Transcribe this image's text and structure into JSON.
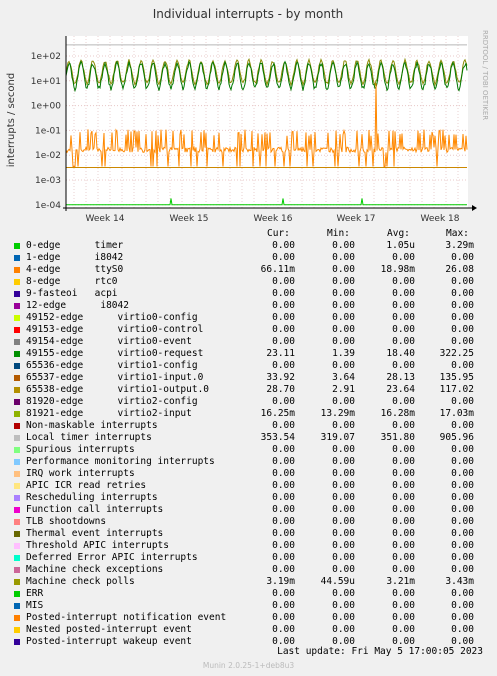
{
  "chart_data": {
    "type": "line",
    "title": "Individual interrupts - by month",
    "ylabel": "interrupts / second",
    "side_label": "RRDTOOL / TOBI OETIKER",
    "yscale": "log",
    "ylim": [
      0.0001,
      300
    ],
    "yticks": [
      "1e+02",
      "1e+01",
      "1e+00",
      "1e-01",
      "1e-02",
      "1e-03",
      "1e-04"
    ],
    "xticks": [
      "Week 14",
      "Week 15",
      "Week 16",
      "Week 17",
      "Week 18"
    ],
    "series_colors": {
      "timer": "#00cc00",
      "local_timer": "#b8b8b8",
      "virtio1_input": "#888800",
      "virtio0_request": "#007700",
      "ttyS0": "#ff8800",
      "mce_polls": "#cc8800",
      "nmi": "#880000"
    },
    "series": [
      {
        "name": "Local timer interrupts",
        "typical": 352,
        "min": 319,
        "max": 906
      },
      {
        "name": "65537-edge virtio1-input.0",
        "typical": 28,
        "min": 3.6,
        "max": 136
      },
      {
        "name": "49155-edge virtio0-request",
        "typical": 18,
        "min": 1.4,
        "max": 322
      },
      {
        "name": "4-edge ttyS0",
        "typical": 0.019,
        "min": 0,
        "max": 26
      },
      {
        "name": "Machine check polls",
        "typical": 0.0032,
        "min": 0.0032,
        "max": 0.0034
      },
      {
        "name": "0-edge timer",
        "typical": 1e-06,
        "min": 0,
        "max": 0.0033
      }
    ]
  },
  "legend": {
    "headers": {
      "cur": "Cur:",
      "min": "Min:",
      "avg": "Avg:",
      "max": "Max:"
    },
    "rows": [
      {
        "color": "#00cc00",
        "name": "0-edge      timer",
        "cur": "0.00",
        "min": "0.00",
        "avg": "1.05u",
        "max": "3.29m"
      },
      {
        "color": "#0066b3",
        "name": "1-edge      i8042",
        "cur": "0.00",
        "min": "0.00",
        "avg": "0.00",
        "max": "0.00"
      },
      {
        "color": "#ff8000",
        "name": "4-edge      ttyS0",
        "cur": "66.11m",
        "min": "0.00",
        "avg": "18.98m",
        "max": "26.08"
      },
      {
        "color": "#ffcc00",
        "name": "8-edge      rtc0",
        "cur": "0.00",
        "min": "0.00",
        "avg": "0.00",
        "max": "0.00"
      },
      {
        "color": "#330099",
        "name": "9-fasteoi   acpi",
        "cur": "0.00",
        "min": "0.00",
        "avg": "0.00",
        "max": "0.00"
      },
      {
        "color": "#990099",
        "name": "12-edge      i8042",
        "cur": "0.00",
        "min": "0.00",
        "avg": "0.00",
        "max": "0.00"
      },
      {
        "color": "#ccff00",
        "name": "49152-edge      virtio0-config",
        "cur": "0.00",
        "min": "0.00",
        "avg": "0.00",
        "max": "0.00"
      },
      {
        "color": "#ff0000",
        "name": "49153-edge      virtio0-control",
        "cur": "0.00",
        "min": "0.00",
        "avg": "0.00",
        "max": "0.00"
      },
      {
        "color": "#808080",
        "name": "49154-edge      virtio0-event",
        "cur": "0.00",
        "min": "0.00",
        "avg": "0.00",
        "max": "0.00"
      },
      {
        "color": "#008f00",
        "name": "49155-edge      virtio0-request",
        "cur": "23.11",
        "min": "1.39",
        "avg": "18.40",
        "max": "322.25"
      },
      {
        "color": "#00487d",
        "name": "65536-edge      virtio1-config",
        "cur": "0.00",
        "min": "0.00",
        "avg": "0.00",
        "max": "0.00"
      },
      {
        "color": "#b35a00",
        "name": "65537-edge      virtio1-input.0",
        "cur": "33.92",
        "min": "3.64",
        "avg": "28.13",
        "max": "135.95"
      },
      {
        "color": "#b38f00",
        "name": "65538-edge      virtio1-output.0",
        "cur": "28.70",
        "min": "2.91",
        "avg": "23.64",
        "max": "117.02"
      },
      {
        "color": "#6b006b",
        "name": "81920-edge      virtio2-config",
        "cur": "0.00",
        "min": "0.00",
        "avg": "0.00",
        "max": "0.00"
      },
      {
        "color": "#8fb300",
        "name": "81921-edge      virtio2-input",
        "cur": "16.25m",
        "min": "13.29m",
        "avg": "16.28m",
        "max": "17.03m"
      },
      {
        "color": "#b30000",
        "name": "Non-maskable interrupts",
        "cur": "0.00",
        "min": "0.00",
        "avg": "0.00",
        "max": "0.00"
      },
      {
        "color": "#bebebe",
        "name": "Local timer interrupts",
        "cur": "353.54",
        "min": "319.07",
        "avg": "351.80",
        "max": "905.96"
      },
      {
        "color": "#80ff80",
        "name": "Spurious interrupts",
        "cur": "0.00",
        "min": "0.00",
        "avg": "0.00",
        "max": "0.00"
      },
      {
        "color": "#80c9ff",
        "name": "Performance monitoring interrupts",
        "cur": "0.00",
        "min": "0.00",
        "avg": "0.00",
        "max": "0.00"
      },
      {
        "color": "#ffc080",
        "name": "IRQ work interrupts",
        "cur": "0.00",
        "min": "0.00",
        "avg": "0.00",
        "max": "0.00"
      },
      {
        "color": "#ffe680",
        "name": "APIC ICR read retries",
        "cur": "0.00",
        "min": "0.00",
        "avg": "0.00",
        "max": "0.00"
      },
      {
        "color": "#aa80ff",
        "name": "Rescheduling interrupts",
        "cur": "0.00",
        "min": "0.00",
        "avg": "0.00",
        "max": "0.00"
      },
      {
        "color": "#ee00cc",
        "name": "Function call interrupts",
        "cur": "0.00",
        "min": "0.00",
        "avg": "0.00",
        "max": "0.00"
      },
      {
        "color": "#ff8080",
        "name": "TLB shootdowns",
        "cur": "0.00",
        "min": "0.00",
        "avg": "0.00",
        "max": "0.00"
      },
      {
        "color": "#666600",
        "name": "Thermal event interrupts",
        "cur": "0.00",
        "min": "0.00",
        "avg": "0.00",
        "max": "0.00"
      },
      {
        "color": "#ffbfff",
        "name": "Threshold APIC interrupts",
        "cur": "0.00",
        "min": "0.00",
        "avg": "0.00",
        "max": "0.00"
      },
      {
        "color": "#00ffcc",
        "name": "Deferred Error APIC interrupts",
        "cur": "0.00",
        "min": "0.00",
        "avg": "0.00",
        "max": "0.00"
      },
      {
        "color": "#cc6699",
        "name": "Machine check exceptions",
        "cur": "0.00",
        "min": "0.00",
        "avg": "0.00",
        "max": "0.00"
      },
      {
        "color": "#999900",
        "name": "Machine check polls",
        "cur": "3.19m",
        "min": "44.59u",
        "avg": "3.21m",
        "max": "3.43m"
      },
      {
        "color": "#00cc00",
        "name": "ERR",
        "cur": "0.00",
        "min": "0.00",
        "avg": "0.00",
        "max": "0.00"
      },
      {
        "color": "#0066b3",
        "name": "MIS",
        "cur": "0.00",
        "min": "0.00",
        "avg": "0.00",
        "max": "0.00"
      },
      {
        "color": "#ff8000",
        "name": "Posted-interrupt notification event",
        "cur": "0.00",
        "min": "0.00",
        "avg": "0.00",
        "max": "0.00"
      },
      {
        "color": "#ffcc00",
        "name": "Nested posted-interrupt event",
        "cur": "0.00",
        "min": "0.00",
        "avg": "0.00",
        "max": "0.00"
      },
      {
        "color": "#330099",
        "name": "Posted-interrupt wakeup event",
        "cur": "0.00",
        "min": "0.00",
        "avg": "0.00",
        "max": "0.00"
      }
    ]
  },
  "footer": {
    "last_update": "Last update:  Fri May  5 17:00:05 2023",
    "generator": "Munin 2.0.25-1+deb8u3"
  }
}
